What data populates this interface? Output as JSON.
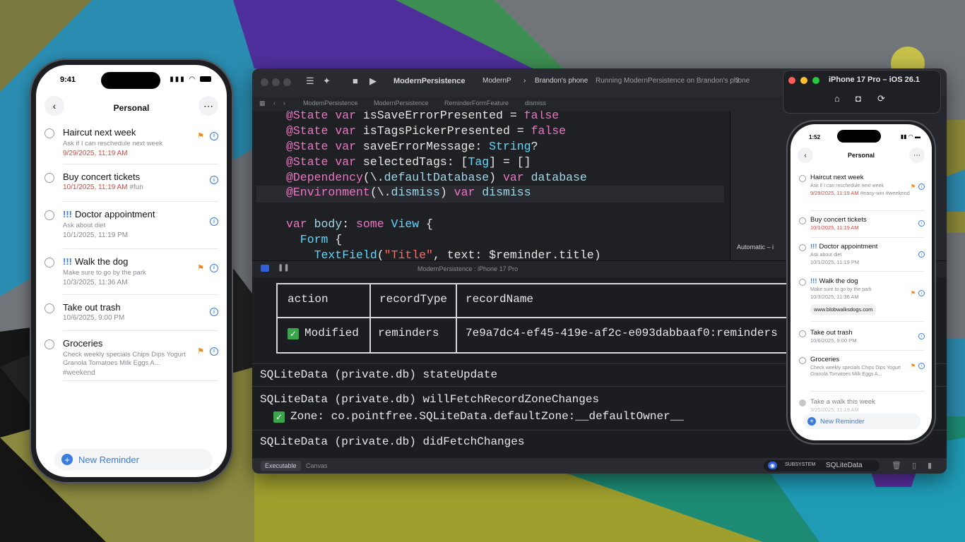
{
  "left_phone": {
    "status_time": "9:41",
    "title": "Personal",
    "reminders": [
      {
        "title": "Haircut next week",
        "priority": "",
        "notes": "Ask if I can reschedule next week",
        "date": "9/29/2025, 11:19 AM",
        "date_red": true,
        "tags": "",
        "flag": true
      },
      {
        "title": "Buy concert tickets",
        "priority": "",
        "notes": "",
        "date": "10/1/2025, 11:19 AM",
        "date_red": true,
        "tags": "#fun",
        "flag": false
      },
      {
        "title": "Doctor appointment",
        "priority": "!!!",
        "notes": "Ask about diet",
        "date": "10/1/2025, 11:19 PM",
        "date_red": false,
        "tags": "",
        "flag": false
      },
      {
        "title": "Walk the dog",
        "priority": "!!!",
        "notes": "Make sure to go by the park",
        "date": "10/3/2025, 11:36 AM",
        "date_red": false,
        "tags": "",
        "flag": true
      },
      {
        "title": "Take out trash",
        "priority": "",
        "notes": "",
        "date": "10/6/2025, 9:00 PM",
        "date_red": false,
        "tags": "",
        "flag": false
      },
      {
        "title": "Groceries",
        "priority": "",
        "notes": "Check weekly specials Chips Dips Yogurt Granola Tomatoes Milk Eggs A...",
        "date": "",
        "date_red": false,
        "tags": "#weekend",
        "flag": true
      }
    ],
    "new_reminder_label": "New Reminder"
  },
  "xcode": {
    "scheme": "ModernPersistence",
    "tab": "ModernP",
    "device": "Brandon's phone",
    "status": "Running ModernPersistence on Brandon's phone",
    "status_count": "3",
    "breadcrumb": [
      "ModernPersistence",
      "ModernPersistence",
      "ReminderFormFeature",
      "dismiss"
    ],
    "code_lines": [
      [
        {
          "t": "@State ",
          "c": "kw"
        },
        {
          "t": "var ",
          "c": "kw"
        },
        {
          "t": "isSaveErrorPresented = ",
          "c": ""
        },
        {
          "t": "false",
          "c": "kw"
        }
      ],
      [
        {
          "t": "@State ",
          "c": "kw"
        },
        {
          "t": "var ",
          "c": "kw"
        },
        {
          "t": "isTagsPickerPresented = ",
          "c": ""
        },
        {
          "t": "false",
          "c": "kw"
        }
      ],
      [
        {
          "t": "@State ",
          "c": "kw"
        },
        {
          "t": "var ",
          "c": "kw"
        },
        {
          "t": "saveErrorMessage: ",
          "c": ""
        },
        {
          "t": "String",
          "c": "ty"
        },
        {
          "t": "?",
          "c": ""
        }
      ],
      [
        {
          "t": "@State ",
          "c": "kw"
        },
        {
          "t": "var ",
          "c": "kw"
        },
        {
          "t": "selectedTags: [",
          "c": ""
        },
        {
          "t": "Tag",
          "c": "ty"
        },
        {
          "t": "] = []",
          "c": ""
        }
      ],
      [
        {
          "t": "@Dependency",
          "c": "kw"
        },
        {
          "t": "(\\.",
          "c": ""
        },
        {
          "t": "defaultDatabase",
          "c": "vr"
        },
        {
          "t": ") ",
          "c": ""
        },
        {
          "t": "var ",
          "c": "kw"
        },
        {
          "t": "database",
          "c": "vr"
        }
      ],
      [
        {
          "t": "@Environment",
          "c": "kw"
        },
        {
          "t": "(\\.",
          "c": ""
        },
        {
          "t": "dismiss",
          "c": "vr"
        },
        {
          "t": ") ",
          "c": ""
        },
        {
          "t": "var ",
          "c": "kw"
        },
        {
          "t": "dismiss",
          "c": "vr"
        }
      ],
      [],
      [
        {
          "t": "var ",
          "c": "kw"
        },
        {
          "t": "body",
          "c": "vr"
        },
        {
          "t": ": ",
          "c": ""
        },
        {
          "t": "some ",
          "c": "kw"
        },
        {
          "t": "View",
          "c": "ty"
        },
        {
          "t": " {",
          "c": ""
        }
      ],
      [
        {
          "t": "  Form",
          "c": "ty"
        },
        {
          "t": " {",
          "c": ""
        }
      ],
      [
        {
          "t": "    TextField",
          "c": "ty"
        },
        {
          "t": "(",
          "c": ""
        },
        {
          "t": "\"Title\"",
          "c": "str"
        },
        {
          "t": ", text: $reminder.title)",
          "c": ""
        }
      ]
    ],
    "debug_label": "ModernPersistence : iPhone 17 Pro",
    "automatic_label": "Automatic – i",
    "table_headers": [
      "action",
      "recordType",
      "recordName"
    ],
    "table_row": {
      "check": "✓",
      "action": "Modified",
      "recordType": "reminders",
      "recordName": "7e9a7dc4-ef45-419e-af2c-e093dabbaaf0:reminders"
    },
    "console_lines": {
      "l1": "SQLiteData (private.db) stateUpdate",
      "l2": "SQLiteData (private.db) willFetchRecordZoneChanges",
      "l3": "Zone: co.pointfree.SQLiteData.defaultZone:__defaultOwner__",
      "l4": "SQLiteData (private.db) didFetchChanges"
    },
    "bottom": {
      "executable": "Executable",
      "canvas": "Canvas",
      "subsystem": "SUBSYSTEM",
      "filter_value": "SQLiteData"
    }
  },
  "simulator": {
    "title": "iPhone 17 Pro – iOS 26.1",
    "status_time": "1:52",
    "nav_title": "Personal",
    "reminders": [
      {
        "title": "Haircut next week",
        "priority": "",
        "notes": "Ask if I can reschedule next week",
        "date": "9/29/2025, 11:19 AM",
        "date_red": true,
        "tags": "#easy-win #weekend",
        "link": "",
        "flag": true
      },
      {
        "title": "Buy concert tickets",
        "priority": "",
        "notes": "",
        "date": "10/1/2025, 11:19 AM",
        "date_red": true,
        "tags": "",
        "link": "",
        "flag": false
      },
      {
        "title": "Doctor appointment",
        "priority": "!!!",
        "notes": "Ask about diet",
        "date": "10/1/2025, 11:19 PM",
        "date_red": false,
        "tags": "",
        "link": "",
        "flag": false
      },
      {
        "title": "Walk the dog",
        "priority": "!!!",
        "notes": "Make sure to go by the park",
        "date": "10/3/2025, 11:36 AM",
        "date_red": false,
        "tags": "",
        "link": "www.blobwalksdogs.com",
        "flag": true
      },
      {
        "title": "Take out trash",
        "priority": "",
        "notes": "",
        "date": "10/6/2025, 9:00 PM",
        "date_red": false,
        "tags": "",
        "link": "",
        "flag": false
      },
      {
        "title": "Groceries",
        "priority": "",
        "notes": "Check weekly specials Chips Dips Yogurt Granola Tomatoes Milk Eggs A...",
        "date": "",
        "date_red": false,
        "tags": "",
        "link": "",
        "flag": true
      },
      {
        "title": "Take a walk this week",
        "priority": "",
        "notes": "",
        "date": "3/25/2025, 11:19 AM",
        "date_red": false,
        "tags": "",
        "link": "",
        "flag": false
      }
    ],
    "new_reminder_label": "New Reminder"
  },
  "colors": {
    "accent": "#3a7be0",
    "flag": "#f08a1c",
    "overdue": "#e0453b",
    "keyword": "#ee74c3",
    "type": "#5dd8ff"
  }
}
